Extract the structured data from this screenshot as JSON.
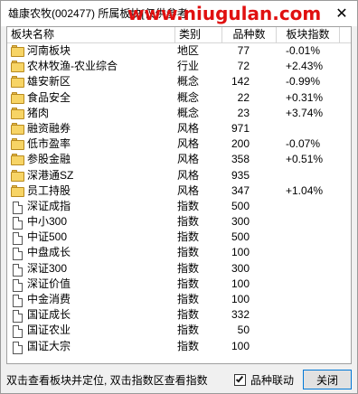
{
  "window": {
    "title": "雄康农牧(002477)  所属板块[仅供参考",
    "watermark": "www.niugulan.com",
    "close_glyph": "✕"
  },
  "table": {
    "headers": {
      "name": "板块名称",
      "type": "类别",
      "count": "品种数",
      "index": "板块指数"
    },
    "rows": [
      {
        "icon": "folder-icon",
        "name": "河南板块",
        "type": "地区",
        "count": "77",
        "index": "-0.01%"
      },
      {
        "icon": "folder-icon",
        "name": "农林牧渔-农业综合",
        "type": "行业",
        "count": "72",
        "index": "+2.43%"
      },
      {
        "icon": "folder-icon",
        "name": "雄安新区",
        "type": "概念",
        "count": "142",
        "index": "-0.99%"
      },
      {
        "icon": "folder-icon",
        "name": "食品安全",
        "type": "概念",
        "count": "22",
        "index": "+0.31%"
      },
      {
        "icon": "folder-icon",
        "name": "猪肉",
        "type": "概念",
        "count": "23",
        "index": "+3.74%"
      },
      {
        "icon": "folder-icon",
        "name": "融资融券",
        "type": "风格",
        "count": "971",
        "index": ""
      },
      {
        "icon": "folder-icon",
        "name": "低市盈率",
        "type": "风格",
        "count": "200",
        "index": "-0.07%"
      },
      {
        "icon": "folder-icon",
        "name": "参股金融",
        "type": "风格",
        "count": "358",
        "index": "+0.51%"
      },
      {
        "icon": "folder-icon",
        "name": "深港通SZ",
        "type": "风格",
        "count": "935",
        "index": ""
      },
      {
        "icon": "folder-icon",
        "name": "员工持股",
        "type": "风格",
        "count": "347",
        "index": "+1.04%"
      },
      {
        "icon": "document-icon",
        "name": "深证成指",
        "type": "指数",
        "count": "500",
        "index": ""
      },
      {
        "icon": "document-icon",
        "name": "中小300",
        "type": "指数",
        "count": "300",
        "index": ""
      },
      {
        "icon": "document-icon",
        "name": "中证500",
        "type": "指数",
        "count": "500",
        "index": ""
      },
      {
        "icon": "document-icon",
        "name": "中盘成长",
        "type": "指数",
        "count": "100",
        "index": ""
      },
      {
        "icon": "document-icon",
        "name": "深证300",
        "type": "指数",
        "count": "300",
        "index": ""
      },
      {
        "icon": "document-icon",
        "name": "深证价值",
        "type": "指数",
        "count": "100",
        "index": ""
      },
      {
        "icon": "document-icon",
        "name": "中金消费",
        "type": "指数",
        "count": "100",
        "index": ""
      },
      {
        "icon": "document-icon",
        "name": "国证成长",
        "type": "指数",
        "count": "332",
        "index": ""
      },
      {
        "icon": "document-icon",
        "name": "国证农业",
        "type": "指数",
        "count": "50",
        "index": ""
      },
      {
        "icon": "document-icon",
        "name": "国证大宗",
        "type": "指数",
        "count": "100",
        "index": ""
      }
    ]
  },
  "statusbar": {
    "hint": "双击查看板块并定位, 双击指数区查看指数",
    "checkbox_label": "品种联动",
    "checkbox_checked": true,
    "close_button": "关闭"
  },
  "colors": {
    "watermark": "#e01010",
    "folder_fill": "#f7d465",
    "button_border": "#0078d7"
  }
}
